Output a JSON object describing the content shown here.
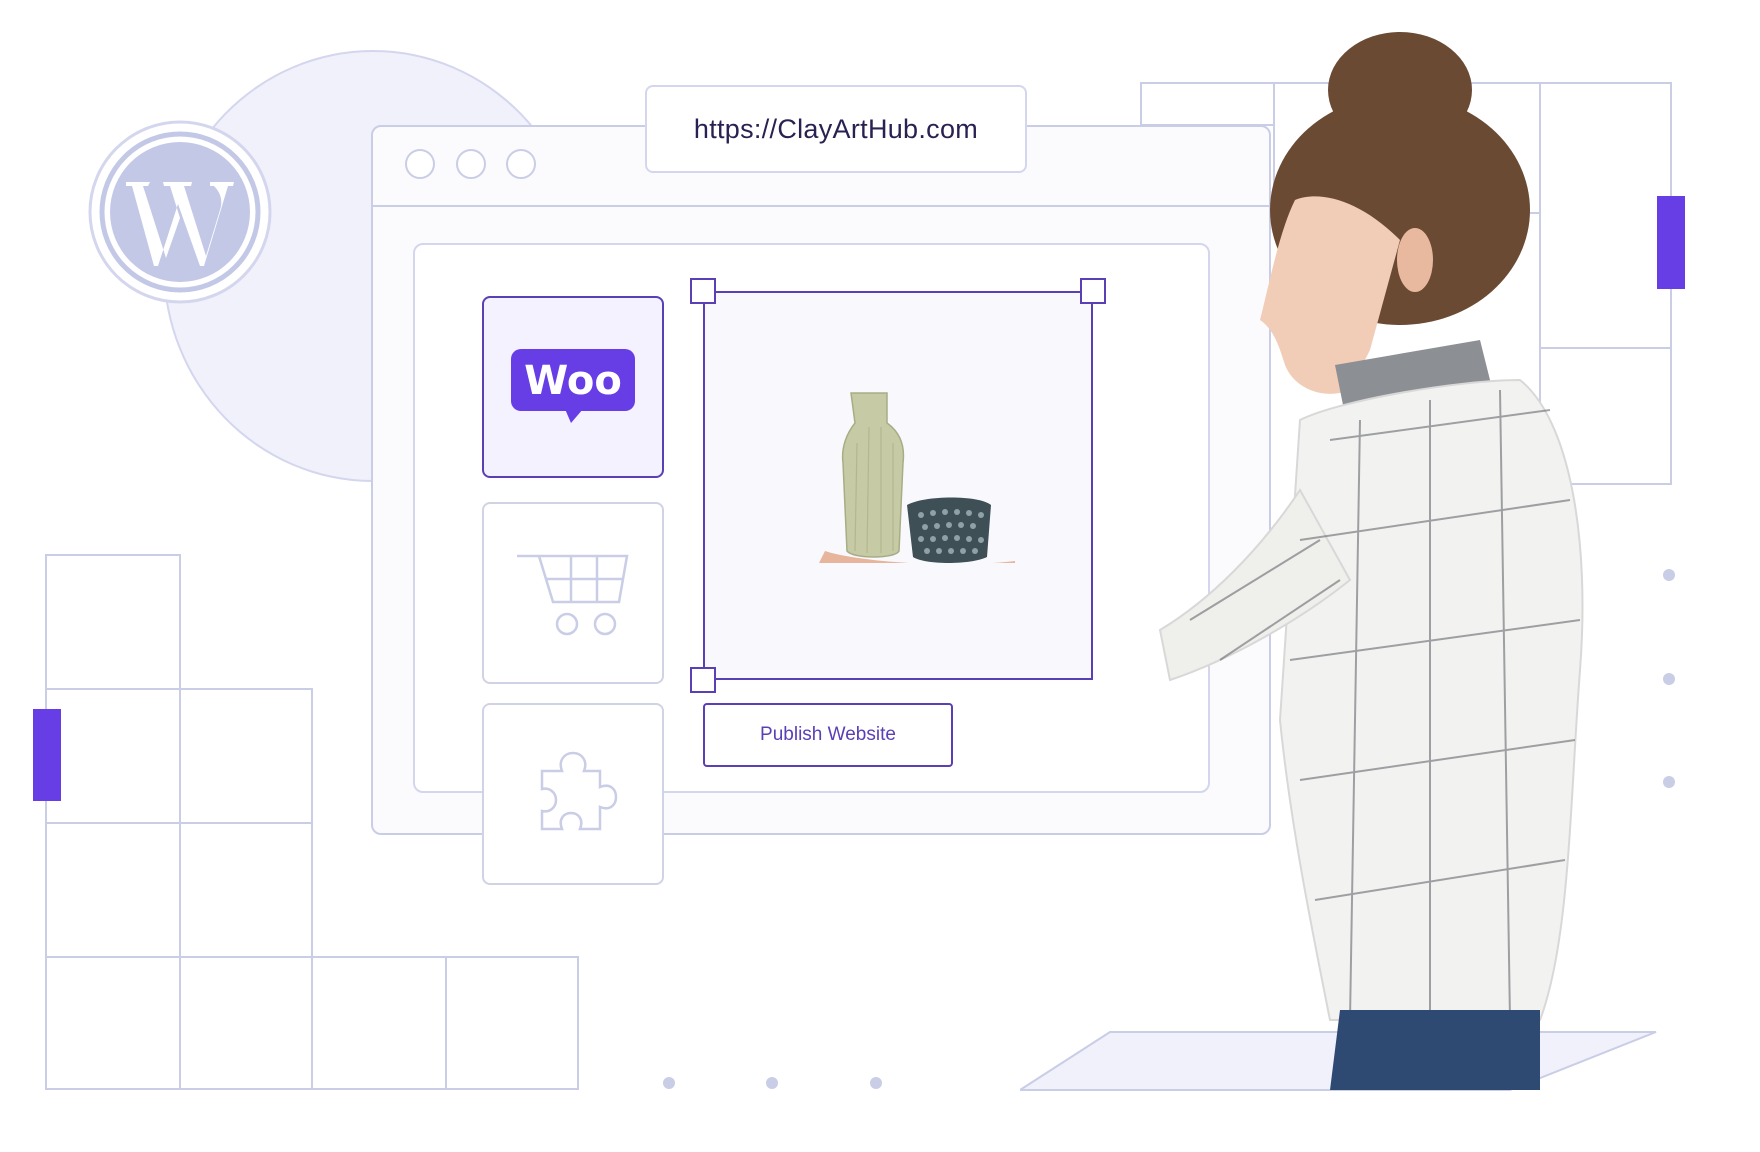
{
  "browser": {
    "url": "https://ClayArtHub.com",
    "window_controls": [
      "dot",
      "dot",
      "dot"
    ]
  },
  "logos": {
    "wordpress": "wordpress-logo",
    "woocommerce_label": "Woo"
  },
  "tiles": [
    {
      "name": "woocommerce",
      "icon": "woo-logo",
      "active": true
    },
    {
      "name": "cart",
      "icon": "shopping-cart-icon",
      "active": false
    },
    {
      "name": "plugins",
      "icon": "puzzle-icon",
      "active": false
    }
  ],
  "product": {
    "items": [
      "vase",
      "textured-cup"
    ]
  },
  "actions": {
    "publish_label": "Publish Website"
  },
  "colors": {
    "accent": "#673de6",
    "frame": "#5b3fb5",
    "line": "#c9cde6",
    "url_text": "#2a2152"
  }
}
